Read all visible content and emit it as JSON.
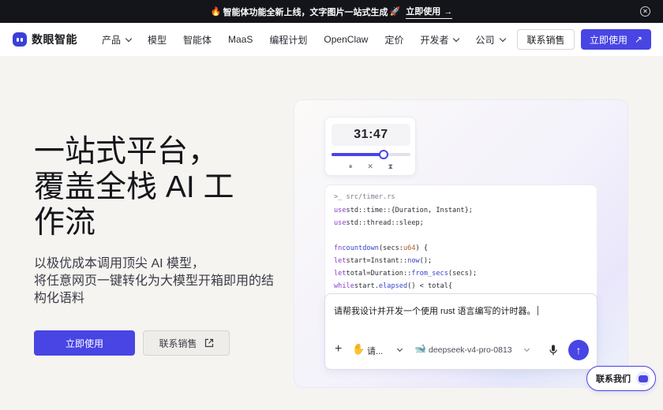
{
  "announcement": {
    "text": "智能体功能全新上线，文字图片一站式生成",
    "cta": "立即使用",
    "cta_arrow": "→",
    "close": "✕"
  },
  "nav": {
    "brand": "数眼智能",
    "items": [
      {
        "label": "产品",
        "dropdown": true
      },
      {
        "label": "模型",
        "dropdown": false
      },
      {
        "label": "智能体",
        "dropdown": false
      },
      {
        "label": "MaaS",
        "dropdown": false
      },
      {
        "label": "编程计划",
        "dropdown": false
      },
      {
        "label": "OpenClaw",
        "dropdown": false
      },
      {
        "label": "定价",
        "dropdown": false
      },
      {
        "label": "开发者",
        "dropdown": true
      },
      {
        "label": "公司",
        "dropdown": true
      }
    ],
    "sales_button": "联系销售",
    "use_button": "立即使用",
    "use_arrow": "↗"
  },
  "hero": {
    "title_lines": [
      "一站式平台，",
      "覆盖全栈 AI 工",
      "作流"
    ],
    "subtitle_lines": [
      "以极优成本调用顶尖 AI 模型，",
      "将任意网页一键转化为大模型开箱即用的结",
      "构化语料"
    ],
    "primary_button": "立即使用",
    "secondary_button": "联系销售"
  },
  "demo": {
    "timer": {
      "time": "31:47",
      "progress": 0.66,
      "controls": [
        "⏸",
        "✕",
        "⧗"
      ]
    },
    "code": {
      "path": ">_ src/timer.rs",
      "lines": [
        "usestd::time::{Duration, Instant};",
        "usestd::thread::sleep;",
        "",
        "fncountdown(secs:u64) {",
        "letstart=Instant::now();",
        "lettotal=Duration::from_secs(secs);",
        "whilestart.elapsed() < total{"
      ]
    },
    "chat": {
      "prompt": "请帮我设计并开发一个使用 rust 语言编写的计时器。",
      "mode_label": "请...",
      "model_name": "deepseek-v4-pro-0813",
      "send_icon": "↑"
    }
  },
  "contact_float": {
    "label": "联系我们"
  },
  "colors": {
    "accent": "#4845e4",
    "announcement_bg": "#14151b",
    "page_bg": "#f6f4f1"
  }
}
